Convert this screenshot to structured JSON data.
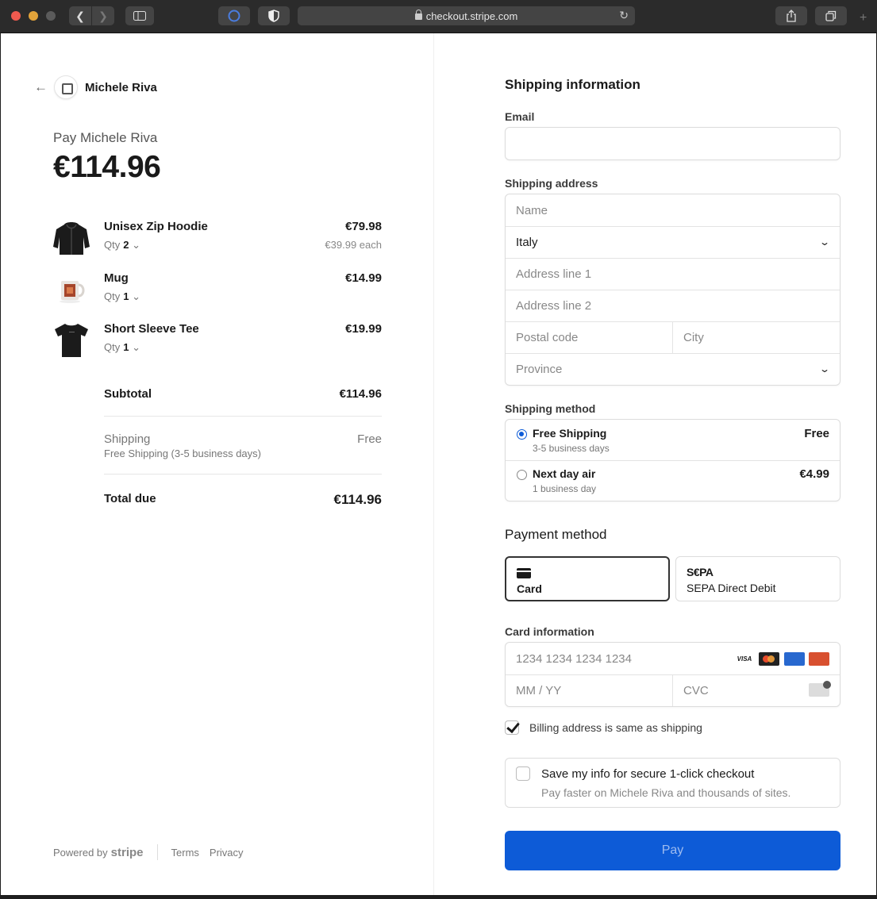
{
  "browser": {
    "url": "checkout.stripe.com"
  },
  "merchant": {
    "name": "Michele Riva",
    "pay_label": "Pay Michele Riva",
    "total": "€114.96"
  },
  "items": [
    {
      "name": "Unisex Zip Hoodie",
      "qty_label": "Qty",
      "qty": "2",
      "price": "€79.98",
      "each": "€39.99 each"
    },
    {
      "name": "Mug",
      "qty_label": "Qty",
      "qty": "1",
      "price": "€14.99",
      "each": ""
    },
    {
      "name": "Short Sleeve Tee",
      "qty_label": "Qty",
      "qty": "1",
      "price": "€19.99",
      "each": ""
    }
  ],
  "summary": {
    "subtotal_label": "Subtotal",
    "subtotal_value": "€114.96",
    "shipping_label": "Shipping",
    "shipping_value": "Free",
    "shipping_detail": "Free Shipping (3-5 business days)",
    "total_label": "Total due",
    "total_value": "€114.96"
  },
  "footer": {
    "powered_by": "Powered by",
    "stripe": "stripe",
    "terms": "Terms",
    "privacy": "Privacy"
  },
  "form": {
    "shipping_title": "Shipping information",
    "email_label": "Email",
    "email_value": "",
    "address_label": "Shipping address",
    "name_placeholder": "Name",
    "country": "Italy",
    "address1_placeholder": "Address line 1",
    "address2_placeholder": "Address line 2",
    "postal_placeholder": "Postal code",
    "city_placeholder": "City",
    "province_placeholder": "Province",
    "shipping_method_label": "Shipping method",
    "shipping_options": [
      {
        "name": "Free Shipping",
        "sub": "3-5 business days",
        "price": "Free",
        "selected": true
      },
      {
        "name": "Next day air",
        "sub": "1 business day",
        "price": "€4.99",
        "selected": false
      }
    ],
    "payment_title": "Payment method",
    "payment_methods": [
      {
        "label": "Card",
        "icon": "card-icon",
        "selected": true
      },
      {
        "label": "SEPA Direct Debit",
        "icon": "sepa-icon",
        "glyph": "S€PA",
        "selected": false
      }
    ],
    "card_info_label": "Card information",
    "card_number_placeholder": "1234 1234 1234 1234",
    "card_brands": {
      "visa": "VISA"
    },
    "expiry_placeholder": "MM / YY",
    "cvc_placeholder": "CVC",
    "billing_same_label": "Billing address is same as shipping",
    "billing_same_checked": true,
    "save_info_title": "Save my info for secure 1-click checkout",
    "save_info_sub": "Pay faster on Michele Riva and thousands of sites.",
    "save_info_checked": false,
    "pay_button": "Pay"
  },
  "colors": {
    "accent": "#0d5bd7",
    "pay_button_text": "#9ebcf0"
  }
}
